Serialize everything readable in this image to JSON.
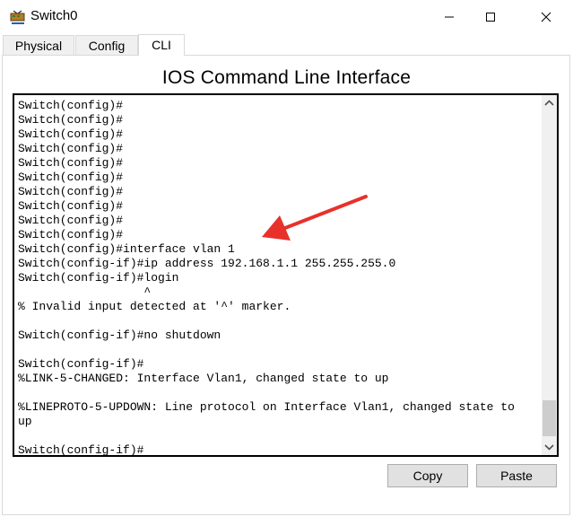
{
  "window": {
    "title": "Switch0",
    "icon": "switch-device-icon"
  },
  "tabs": [
    {
      "label": "Physical",
      "active": false
    },
    {
      "label": "Config",
      "active": false
    },
    {
      "label": "CLI",
      "active": true
    }
  ],
  "cli": {
    "heading": "IOS Command Line Interface",
    "lines": [
      "Switch(config)#",
      "Switch(config)#",
      "Switch(config)#",
      "Switch(config)#",
      "Switch(config)#",
      "Switch(config)#",
      "Switch(config)#",
      "Switch(config)#",
      "Switch(config)#",
      "Switch(config)#",
      "Switch(config)#interface vlan 1",
      "Switch(config-if)#ip address 192.168.1.1 255.255.255.0",
      "Switch(config-if)#login",
      "                  ^",
      "% Invalid input detected at '^' marker.",
      "",
      "Switch(config-if)#no shutdown",
      "",
      "Switch(config-if)#",
      "%LINK-5-CHANGED: Interface Vlan1, changed state to up",
      "",
      "%LINEPROTO-5-UPDOWN: Line protocol on Interface Vlan1, changed state to",
      "up",
      "",
      "Switch(config-if)#"
    ]
  },
  "buttons": {
    "copy": "Copy",
    "paste": "Paste"
  },
  "annotation_color": "#e8312a"
}
